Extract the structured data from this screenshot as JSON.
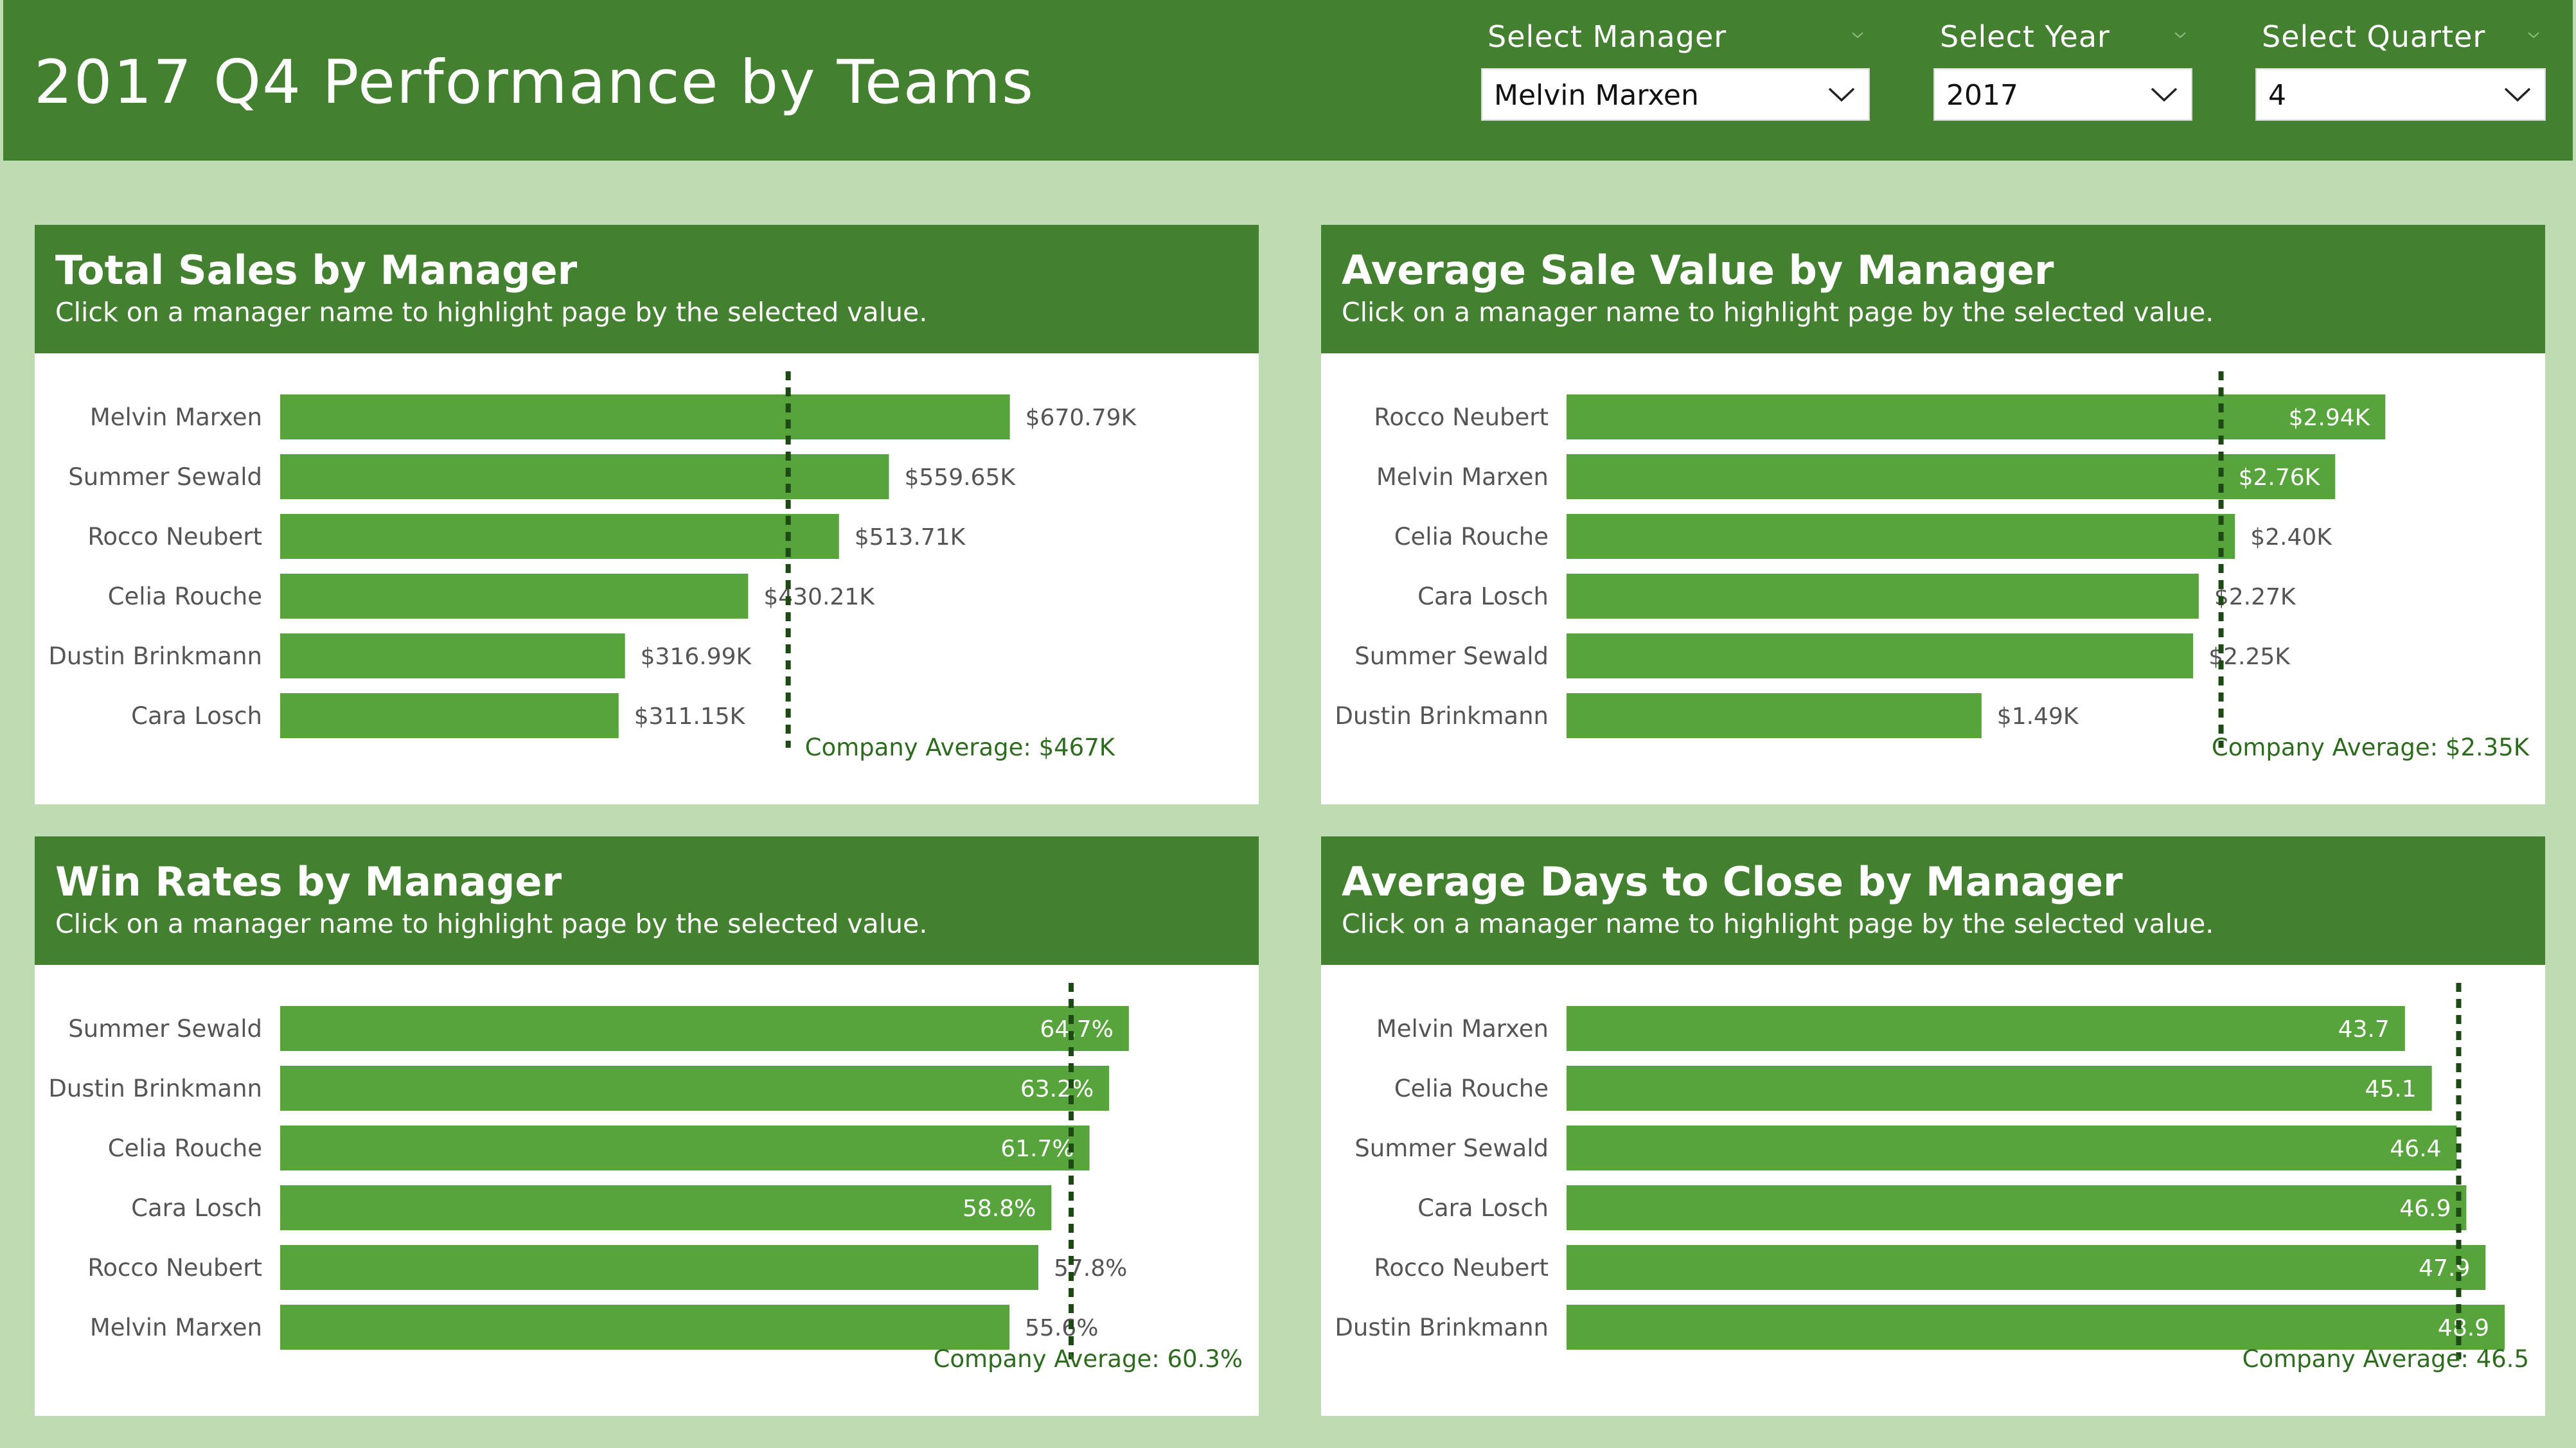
{
  "header": {
    "title": "2017 Q4 Performance by Teams",
    "filters": [
      {
        "label": "Select Manager",
        "value": "Melvin Marxen"
      },
      {
        "label": "Select Year",
        "value": "2017"
      },
      {
        "label": "Select Quarter",
        "value": "4"
      }
    ]
  },
  "colors": {
    "background": "#bfdbb2",
    "header": "#43802f",
    "bar": "#57a33c",
    "average_line": "#1d4a14",
    "average_text": "#2d6b1e"
  },
  "chart_data": [
    {
      "type": "bar",
      "orientation": "horizontal",
      "title": "Total Sales by Manager",
      "subtitle": "Click on a manager name to highlight page by the selected value.",
      "categories": [
        "Melvin Marxen",
        "Summer Sewald",
        "Rocco Neubert",
        "Celia Rouche",
        "Dustin Brinkmann",
        "Cara Losch"
      ],
      "values": [
        670.79,
        559.65,
        513.71,
        430.21,
        316.99,
        311.15
      ],
      "value_labels": [
        "$670.79K",
        "$559.65K",
        "$513.71K",
        "$430.21K",
        "$316.99K",
        "$311.15K"
      ],
      "units": "thousand USD",
      "xlim": [
        0,
        873
      ],
      "average": 467,
      "average_label": "Company Average: $467K"
    },
    {
      "type": "bar",
      "orientation": "horizontal",
      "title": "Average Sale Value by Manager",
      "subtitle": "Click on a manager name to highlight page by the selected value.",
      "categories": [
        "Rocco Neubert",
        "Melvin Marxen",
        "Celia Rouche",
        "Cara Losch",
        "Summer Sewald",
        "Dustin Brinkmann"
      ],
      "values": [
        2.94,
        2.76,
        2.4,
        2.27,
        2.25,
        1.49
      ],
      "value_labels": [
        "$2.94K",
        "$2.76K",
        "$2.40K",
        "$2.27K",
        "$2.25K",
        "$1.49K"
      ],
      "units": "thousand USD",
      "xlim": [
        0,
        3.41
      ],
      "average": 2.35,
      "average_label": "Company Average: $2.35K"
    },
    {
      "type": "bar",
      "orientation": "horizontal",
      "title": "Win Rates by Manager",
      "subtitle": "Click on a manager name to highlight page by the selected value.",
      "categories": [
        "Summer Sewald",
        "Dustin Brinkmann",
        "Celia Rouche",
        "Cara Losch",
        "Rocco Neubert",
        "Melvin Marxen"
      ],
      "values": [
        64.7,
        63.2,
        61.7,
        58.8,
        57.8,
        55.6
      ],
      "value_labels": [
        "64.7%",
        "63.2%",
        "61.7%",
        "58.8%",
        "57.8%",
        "55.6%"
      ],
      "units": "percent",
      "xlim": [
        0,
        72.4
      ],
      "average": 60.3,
      "average_label": "Company Average: 60.3%"
    },
    {
      "type": "bar",
      "orientation": "horizontal",
      "title": "Average Days to Close by Manager",
      "subtitle": "Click on a manager name to highlight page by the selected value.",
      "categories": [
        "Melvin Marxen",
        "Celia Rouche",
        "Summer Sewald",
        "Cara Losch",
        "Rocco Neubert",
        "Dustin Brinkmann"
      ],
      "values": [
        43.7,
        45.1,
        46.4,
        46.9,
        47.9,
        48.9
      ],
      "value_labels": [
        "43.7",
        "45.1",
        "46.4",
        "46.9",
        "47.9",
        "48.9"
      ],
      "units": "days",
      "xlim": [
        0,
        49.5
      ],
      "average": 46.5,
      "average_label": "Company Average: 46.5"
    }
  ]
}
